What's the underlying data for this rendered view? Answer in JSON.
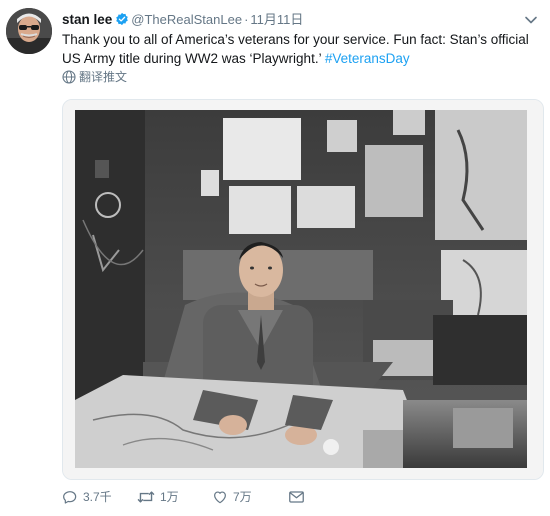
{
  "tweet": {
    "author_name": "stan lee",
    "handle": "@TheRealStanLee",
    "separator": "·",
    "date": "11月11日",
    "text": "Thank you to all of America’s veterans for your service. Fun fact: Stan’s official US Army title during WW2 was ‘Playwright.’",
    "hashtag": "#VeteransDay",
    "translate_label": "翻译推文"
  },
  "actions": {
    "reply_count": "3.7千",
    "retweet_count": "1万",
    "like_count": "7万"
  },
  "icons": {
    "verified": "verified-badge-icon",
    "chevron": "chevron-down-icon",
    "translate": "globe-icon",
    "reply": "reply-icon",
    "retweet": "retweet-icon",
    "like": "heart-icon",
    "dm": "envelope-icon"
  },
  "colors": {
    "accent": "#1da1f2",
    "secondary_text": "#657786"
  }
}
